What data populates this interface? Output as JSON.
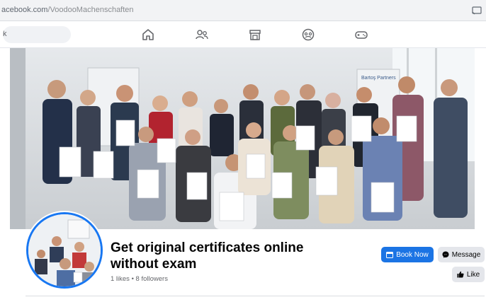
{
  "browser": {
    "url_main": "acebook.com",
    "url_path": "/VoodooMachenschaften"
  },
  "topnav": {
    "search_placeholder": "k",
    "icons": [
      "home-icon",
      "friends-icon",
      "marketplace-icon",
      "groups-icon",
      "gaming-icon"
    ]
  },
  "cover": {
    "banner_text": "Bartoş Partners"
  },
  "page": {
    "title": "Get original certificates online without exam",
    "likes": "1 likes",
    "separator": "•",
    "followers": "8 followers"
  },
  "actions": {
    "book_now": "Book Now",
    "message": "Message",
    "like": "Like"
  },
  "colors": {
    "primary": "#1b74e4",
    "avatar_ring": "#1877f2",
    "secondary_button": "#e4e6eb"
  }
}
